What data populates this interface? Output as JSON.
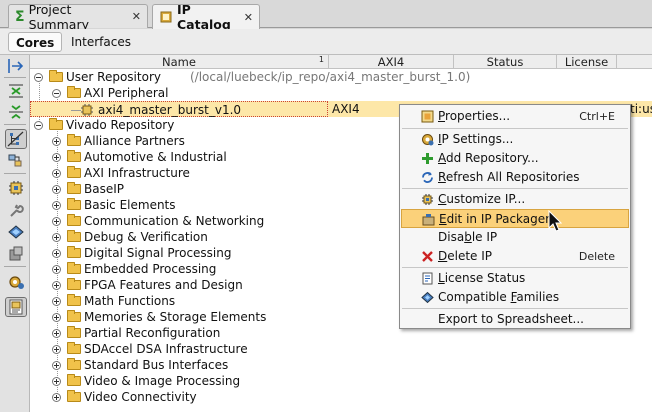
{
  "tabs": [
    {
      "label": "Project Summary",
      "icon": "sigma-icon",
      "close": "✕"
    },
    {
      "label": "IP Catalog",
      "icon": "ip-catalog-icon",
      "close": "✕"
    }
  ],
  "subtabs": [
    {
      "label": "Cores",
      "active": true
    },
    {
      "label": "Interfaces",
      "active": false
    }
  ],
  "columns": {
    "name": "Name",
    "name_sort": "1",
    "axi4": "AXI4",
    "status": "Status",
    "license": "License"
  },
  "tree": {
    "user_repo": {
      "label": "User Repository",
      "path": "(/local/luebeck/ip_repo/axi4_master_burst_1.0)"
    },
    "axi_peripheral": "AXI Peripheral",
    "selected_ip": {
      "label": "axi4_master_burst_v1.0",
      "axi4": "AXI4",
      "license_partial": "ti:us"
    },
    "vivado_repo": "Vivado Repository",
    "categories": [
      "Alliance Partners",
      "Automotive & Industrial",
      "AXI Infrastructure",
      "BaseIP",
      "Basic Elements",
      "Communication & Networking",
      "Debug & Verification",
      "Digital Signal Processing",
      "Embedded Processing",
      "FPGA Features and Design",
      "Math Functions",
      "Memories & Storage Elements",
      "Partial Reconfiguration",
      "SDAccel DSA Infrastructure",
      "Standard Bus Interfaces",
      "Video & Image Processing",
      "Video Connectivity"
    ]
  },
  "context_menu": {
    "items": [
      {
        "pre": "",
        "u": "P",
        "post": "roperties...",
        "accel": "Ctrl+E",
        "icon": "properties-icon"
      },
      {
        "pre": "",
        "u": "I",
        "post": "P Settings...",
        "accel": "",
        "icon": "ip-settings-icon"
      },
      {
        "pre": "",
        "u": "A",
        "post": "dd Repository...",
        "accel": "",
        "icon": "add-icon"
      },
      {
        "pre": "",
        "u": "R",
        "post": "efresh All Repositories",
        "accel": "",
        "icon": "refresh-icon"
      },
      {
        "pre": "",
        "u": "C",
        "post": "ustomize IP...",
        "accel": "",
        "icon": "customize-icon"
      },
      {
        "pre": "",
        "u": "E",
        "post": "dit in IP Packager",
        "accel": "",
        "icon": "packager-icon"
      },
      {
        "pre": "Disa",
        "u": "b",
        "post": "le IP",
        "accel": "",
        "icon": ""
      },
      {
        "pre": "",
        "u": "D",
        "post": "elete IP",
        "accel": "Delete",
        "icon": "delete-icon"
      },
      {
        "pre": "",
        "u": "L",
        "post": "icense Status",
        "accel": "",
        "icon": "license-icon"
      },
      {
        "pre": "Compatible ",
        "u": "F",
        "post": "amilies",
        "accel": "",
        "icon": "families-icon"
      },
      {
        "pre": "Export to Spreadsheet...",
        "u": "",
        "post": "",
        "accel": "",
        "icon": ""
      }
    ],
    "highlighted": "Edit in IP Packager"
  },
  "colors": {
    "selection": "#fde7a8",
    "menu_highlight": "#fbd17a",
    "folder": "#f0c24a",
    "add_green": "#2e9b2e",
    "delete_red": "#cc2222"
  }
}
